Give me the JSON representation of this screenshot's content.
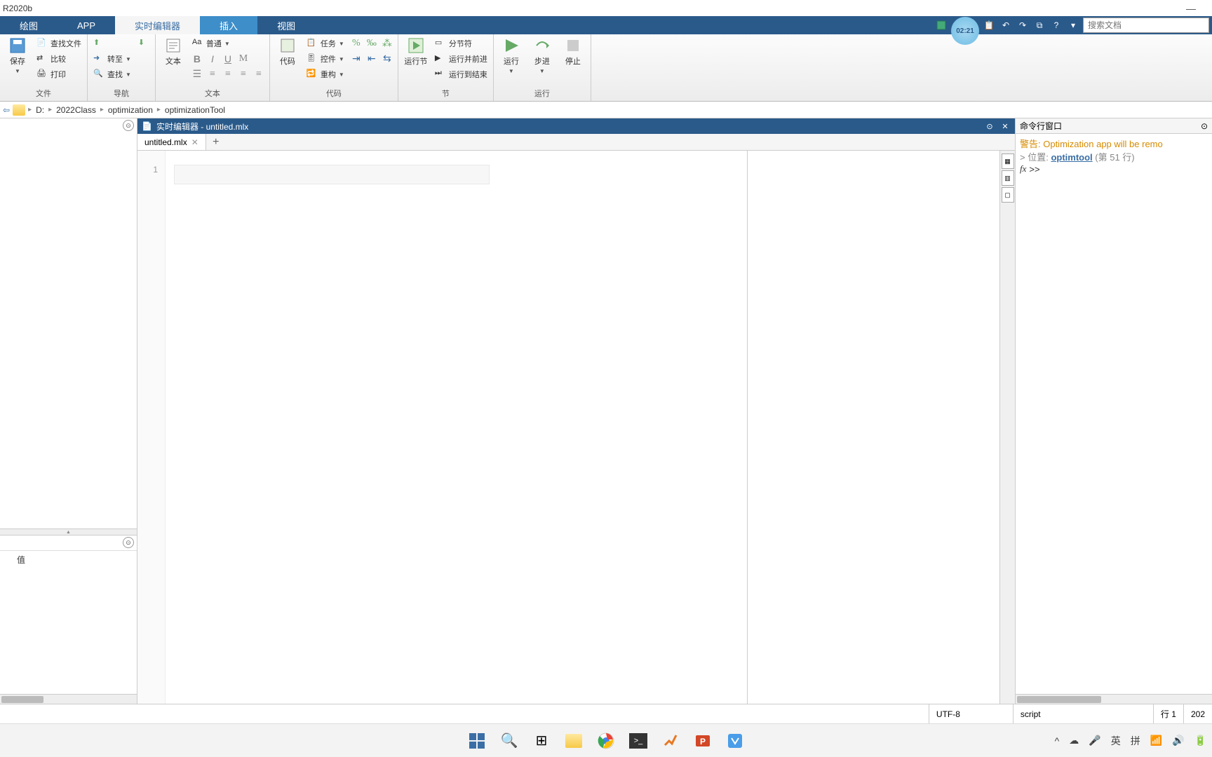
{
  "titlebar": {
    "title": "R2020b"
  },
  "tabs": {
    "drawing": "绘图",
    "app": "APP",
    "live_editor": "实时编辑器",
    "insert": "插入",
    "view": "视图"
  },
  "search": {
    "placeholder": "搜索文档"
  },
  "timer": {
    "value": "02:21"
  },
  "ribbon": {
    "file_group": "文件",
    "save": "保存",
    "find_files": "查找文件",
    "compare": "比较",
    "print": "打印",
    "nav_group": "导航",
    "goto": "转至",
    "find": "查找",
    "text_group": "文本",
    "text_btn": "文本",
    "style_normal": "普通",
    "code_group": "代码",
    "code_btn": "代码",
    "tasks": "任务",
    "controls": "控件",
    "refactor": "重构",
    "section_group": "节",
    "run_section": "运行节",
    "section_break": "分节符",
    "run_advance": "运行并前进",
    "run_to_end": "运行到结束",
    "run_group": "运行",
    "run": "运行",
    "step": "步进",
    "stop": "停止"
  },
  "path": {
    "drive": "D:",
    "seg1": "2022Class",
    "seg2": "optimization",
    "seg3": "optimizationTool"
  },
  "editor": {
    "panel_title": "实时编辑器 - untitled.mlx",
    "tab_name": "untitled.mlx",
    "line1": "1"
  },
  "workspace": {
    "value_header": "值"
  },
  "cmd": {
    "title": "命令行窗口",
    "warning": "警告: Optimization app will be remo",
    "location_prefix": "> 位置:",
    "link": "optimtool",
    "paren": "(第 51 行)",
    "prompt": ">>"
  },
  "status": {
    "encoding": "UTF-8",
    "mode": "script",
    "line_label": "行",
    "line_num": "1",
    "year": "202"
  },
  "tray": {
    "lang1": "英",
    "lang2": "拼"
  }
}
